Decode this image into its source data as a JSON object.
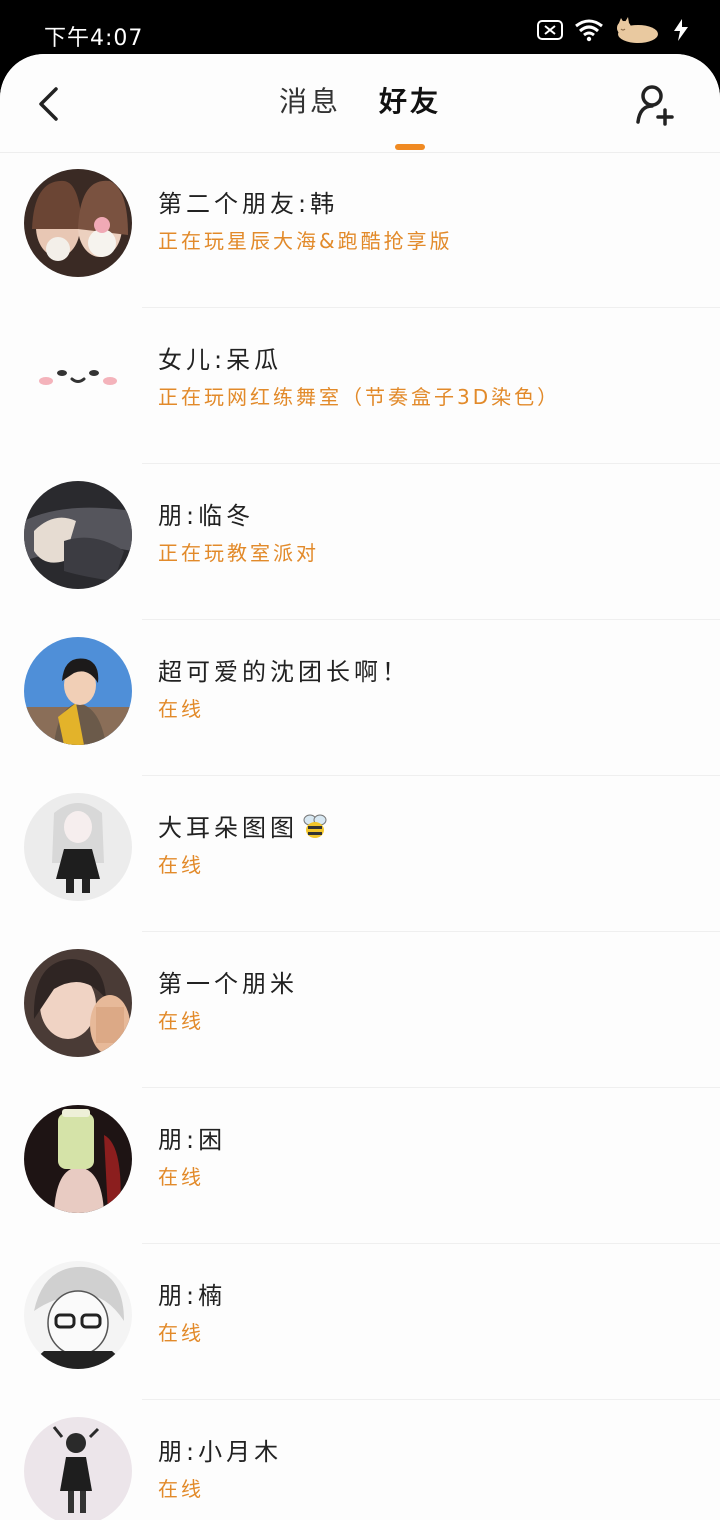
{
  "status_bar": {
    "time": "下午4:07",
    "icons": [
      "sim-off-icon",
      "wifi-icon",
      "sleeping-pet-icon",
      "charging-icon"
    ]
  },
  "header": {
    "tabs": [
      {
        "label": "消息",
        "active": false
      },
      {
        "label": "好友",
        "active": true
      }
    ],
    "back_icon": "chevron-left-icon",
    "add_friend_icon": "add-user-icon",
    "accent_color": "#f08a22"
  },
  "friends": [
    {
      "name": "第二个朋友:韩",
      "status": "正在玩星辰大海&跑酷抢享版"
    },
    {
      "name": "女儿:呆瓜",
      "status": "正在玩网红练舞室（节奏盒子3D染色）"
    },
    {
      "name": "朋:临冬",
      "status": "正在玩教室派对"
    },
    {
      "name": "超可爱的沈团长啊！",
      "status": "在线"
    },
    {
      "name": "大耳朵图图",
      "status": "在线"
    },
    {
      "name": "第一个朋米",
      "status": "在线"
    },
    {
      "name": "朋:困",
      "status": "在线"
    },
    {
      "name": "朋:楠",
      "status": "在线"
    },
    {
      "name": "朋:小月木",
      "status": "在线"
    }
  ],
  "colors": {
    "status_text": "#e28a2a",
    "name_text": "#222222"
  }
}
